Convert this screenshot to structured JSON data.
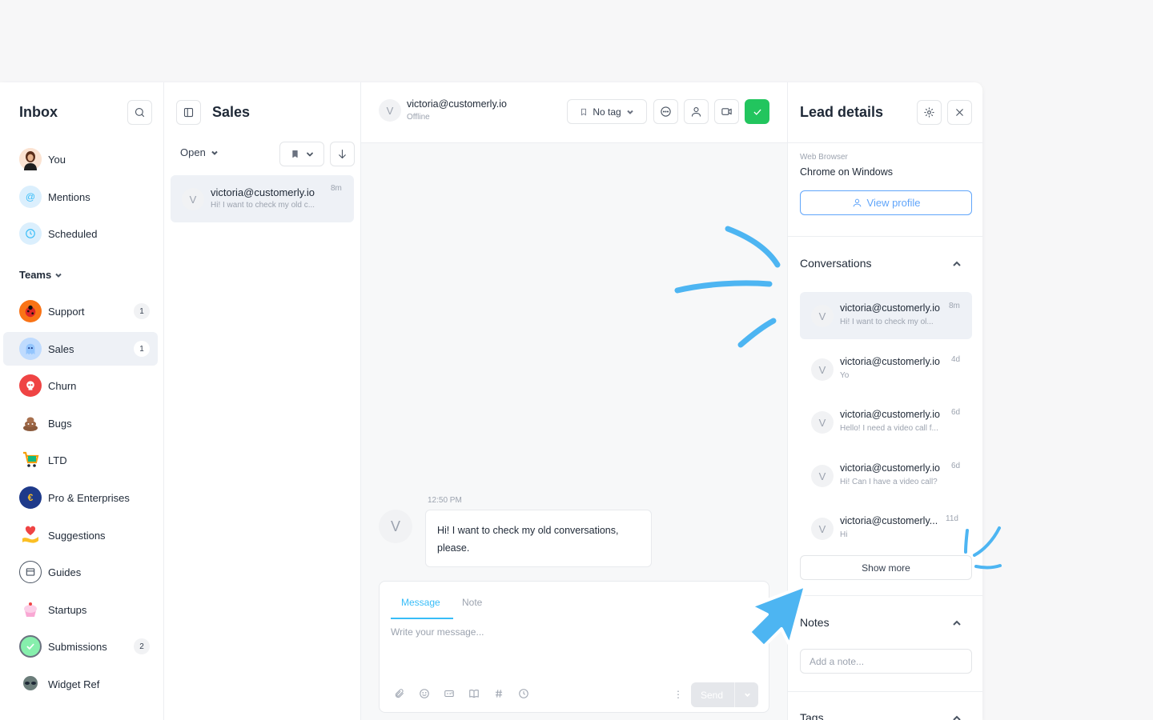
{
  "colors": {
    "accent": "#38bdf8",
    "success": "#22c55e",
    "decoration": "#4db5f2"
  },
  "inbox": {
    "title": "Inbox",
    "personal": [
      {
        "label": "You",
        "icon": "user-avatar"
      },
      {
        "label": "Mentions",
        "icon": "at-icon"
      },
      {
        "label": "Scheduled",
        "icon": "clock-icon"
      }
    ],
    "teams_label": "Teams",
    "teams": [
      {
        "label": "Support",
        "count": "1",
        "icon": "ladybug-avatar"
      },
      {
        "label": "Sales",
        "count": "1",
        "icon": "ghost-avatar"
      },
      {
        "label": "Churn",
        "count": "",
        "icon": "skull-avatar"
      },
      {
        "label": "Bugs",
        "count": "",
        "icon": "poop-avatar"
      },
      {
        "label": "LTD",
        "count": "",
        "icon": "cart-avatar"
      },
      {
        "label": "Pro & Enterprises",
        "count": "",
        "icon": "euro-coin-avatar"
      },
      {
        "label": "Suggestions",
        "count": "",
        "icon": "heart-hand-avatar"
      },
      {
        "label": "Guides",
        "count": "",
        "icon": "book-avatar"
      },
      {
        "label": "Startups",
        "count": "",
        "icon": "cupcake-avatar"
      },
      {
        "label": "Submissions",
        "count": "2",
        "icon": "check-circle-avatar"
      },
      {
        "label": "Widget Ref",
        "count": "",
        "icon": "alien-avatar"
      }
    ]
  },
  "sales": {
    "title": "Sales",
    "filter": "Open",
    "conversation": {
      "initial": "V",
      "email": "victoria@customerly.io",
      "preview": "Hi! I want to check my old c...",
      "time": "8m"
    }
  },
  "chat": {
    "contact_initial": "V",
    "contact_email": "victoria@customerly.io",
    "contact_status": "Offline",
    "tag_label": "No tag",
    "message_time": "12:50 PM",
    "message_initial": "V",
    "message_text": "Hi! I want to check my old conversations, please.",
    "composer": {
      "tab_message": "Message",
      "tab_note": "Note",
      "placeholder": "Write your message...",
      "send_label": "Send"
    }
  },
  "lead": {
    "title": "Lead details",
    "browser_label": "Web Browser",
    "browser_value": "Chrome on Windows",
    "view_profile": "View profile",
    "conversations_title": "Conversations",
    "conversations": [
      {
        "initial": "V",
        "email": "victoria@customerly.io",
        "preview": "Hi! I want to check my ol...",
        "time": "8m"
      },
      {
        "initial": "V",
        "email": "victoria@customerly.io",
        "preview": "Yo",
        "time": "4d"
      },
      {
        "initial": "V",
        "email": "victoria@customerly.io",
        "preview": "Hello! I need a video call f...",
        "time": "6d"
      },
      {
        "initial": "V",
        "email": "victoria@customerly.io",
        "preview": "Hi! Can I have a video call?",
        "time": "6d"
      },
      {
        "initial": "V",
        "email": "victoria@customerly...",
        "preview": "Hi",
        "time": "11d"
      }
    ],
    "show_more": "Show more",
    "notes_title": "Notes",
    "notes_placeholder": "Add a note...",
    "tags_title": "Tags"
  }
}
